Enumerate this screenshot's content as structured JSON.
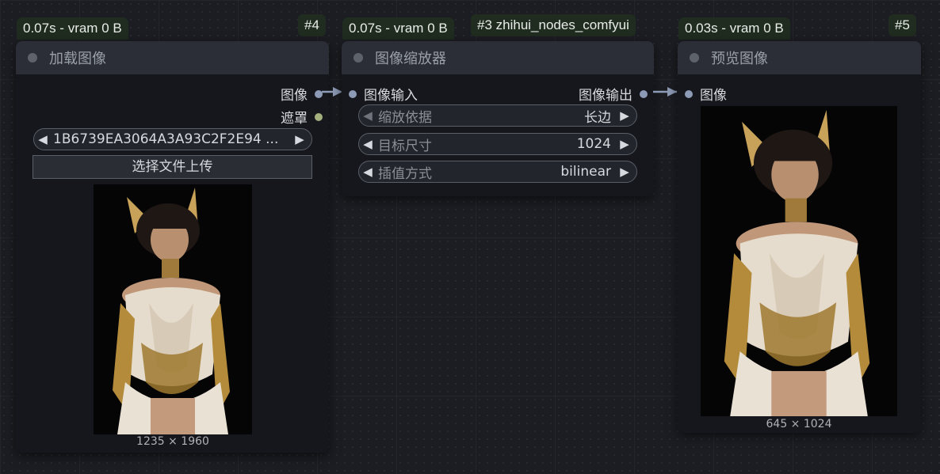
{
  "nodes": {
    "load_image": {
      "timing": "0.07s - vram 0 B",
      "id": "#4",
      "title": "加载图像",
      "outputs": [
        "图像",
        "遮罩"
      ],
      "file_value": "1B6739EA3064A3A93C2F2E94 ...",
      "upload_label": "选择文件上传",
      "image_dims": "1235 × 1960"
    },
    "image_scaler": {
      "timing": "0.07s - vram 0 B",
      "id": "#3 zhihui_nodes_comfyui",
      "title": "图像缩放器",
      "input_label": "图像输入",
      "output_label": "图像输出",
      "widgets": [
        {
          "label": "缩放依据",
          "value": "长边"
        },
        {
          "label": "目标尺寸",
          "value": "1024"
        },
        {
          "label": "插值方式",
          "value": "bilinear"
        }
      ]
    },
    "preview_image": {
      "timing": "0.03s - vram 0 B",
      "id": "#5",
      "title": "预览图像",
      "input_label": "图像",
      "image_dims": "645 × 1024"
    }
  },
  "colors": {
    "canvas": "#1b1d22",
    "node_body": "#15171c",
    "node_title": "#2b2e36",
    "badge": "#1f2c1f",
    "image_port": "#8e9bb6",
    "mask_port": "#a5b07f"
  }
}
